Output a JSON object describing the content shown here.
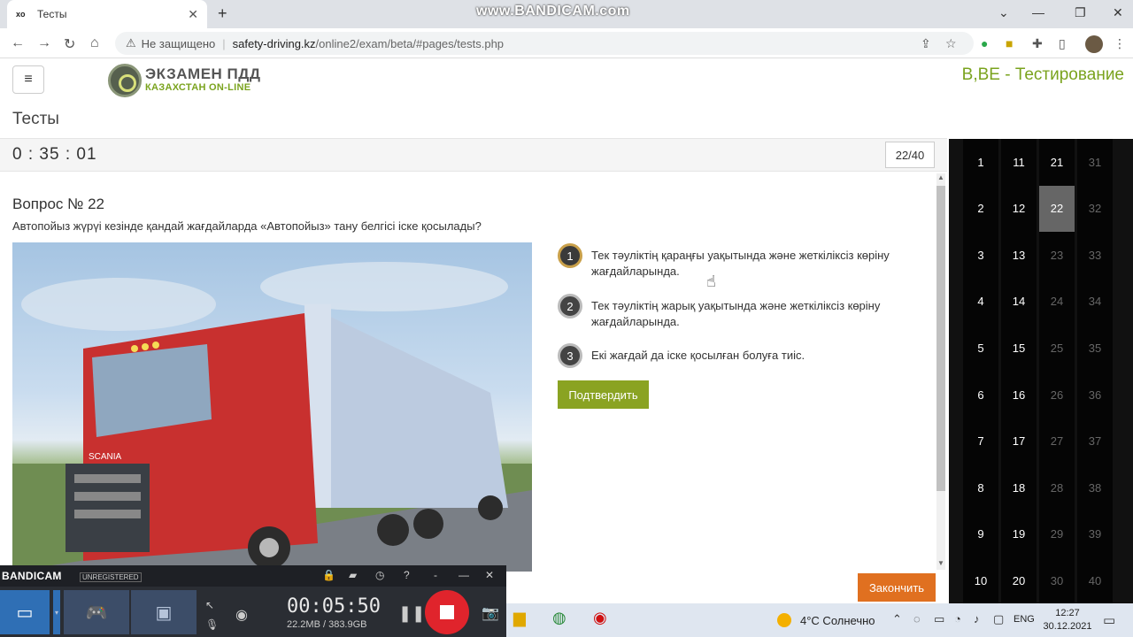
{
  "browser": {
    "tab_title": "Тесты",
    "tab_favicon": "xo",
    "watermark": "www.BANDICAM.com",
    "security_label": "Не защищено",
    "url_domain": "safety-driving.kz",
    "url_path": "/online2/exam/beta/#pages/tests.php"
  },
  "header": {
    "logo_title": "ЭКЗАМЕН ПДД",
    "logo_subtitle": "КАЗАХСТАН ON-LINE",
    "mode_title": "B,BE - Тестирование"
  },
  "page": {
    "section_title": "Тесты",
    "timer": "0 : 35 : 01",
    "progress": "22/40"
  },
  "question": {
    "title": "Вопрос № 22",
    "text": "Автопойыз жүрүі кезінде қандай жағдайларда «Автопойыз» тану белгісі іске қосылады?",
    "answers": [
      {
        "num": "1",
        "text": "Тек тәуліктің қараңғы уақытында және жеткіліксіз көріну жағдайларында.",
        "selected": true
      },
      {
        "num": "2",
        "text": "Тек тәуліктің жарық уақытында және жеткіліксіз көріну жағдайларында.",
        "selected": false
      },
      {
        "num": "3",
        "text": "Екі жағдай да іске қосылған болуға тиіс.",
        "selected": false
      }
    ],
    "confirm_label": "Подтвердить",
    "finish_label": "Закончить"
  },
  "grid": {
    "columns": [
      [
        "1",
        "2",
        "3",
        "4",
        "5",
        "6",
        "7",
        "8",
        "9",
        "10"
      ],
      [
        "11",
        "12",
        "13",
        "14",
        "15",
        "16",
        "17",
        "18",
        "19",
        "20"
      ],
      [
        "21",
        "22",
        "23",
        "24",
        "25",
        "26",
        "27",
        "28",
        "29",
        "30"
      ],
      [
        "31",
        "32",
        "33",
        "34",
        "35",
        "36",
        "37",
        "38",
        "39",
        "40"
      ]
    ],
    "current": "22",
    "answered_upto": 21
  },
  "bandicam": {
    "logo": "BANDICAM",
    "unregistered": "UNREGISTERED",
    "time": "00:05:50",
    "size": "22.2MB / 383.9GB"
  },
  "taskbar": {
    "weather": "4°C  Солнечно",
    "lang": "ENG",
    "time": "12:27",
    "date": "30.12.2021"
  }
}
